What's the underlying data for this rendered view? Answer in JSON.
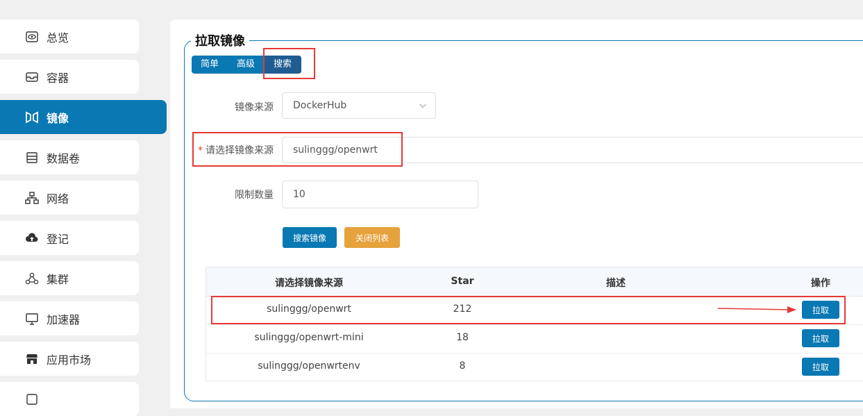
{
  "sidebar": {
    "items": [
      {
        "label": "总览",
        "icon": "eye-icon"
      },
      {
        "label": "容器",
        "icon": "inbox-icon"
      },
      {
        "label": "镜像",
        "icon": "image-icon",
        "active": true
      },
      {
        "label": "数据卷",
        "icon": "database-icon"
      },
      {
        "label": "网络",
        "icon": "network-icon"
      },
      {
        "label": "登记",
        "icon": "cloud-upload-icon"
      },
      {
        "label": "集群",
        "icon": "cluster-icon"
      },
      {
        "label": "加速器",
        "icon": "monitor-icon"
      },
      {
        "label": "应用市场",
        "icon": "store-icon"
      }
    ]
  },
  "panel": {
    "title": "拉取镜像",
    "tabs": [
      "简单",
      "高级",
      "搜索"
    ],
    "selected_tab": "搜索"
  },
  "form": {
    "source_label": "镜像来源",
    "source_value": "DockerHub",
    "required_mark": "*",
    "search_label": "请选择镜像来源",
    "search_value": "sulinggg/openwrt",
    "limit_label": "限制数量",
    "limit_value": "10",
    "search_button": "搜索镜像",
    "close_button": "关闭列表"
  },
  "table": {
    "headers": [
      "请选择镜像来源",
      "Star",
      "描述",
      "操作"
    ],
    "rows": [
      {
        "name": "sulinggg/openwrt",
        "star": "212",
        "desc": "",
        "action": "拉取"
      },
      {
        "name": "sulinggg/openwrt-mini",
        "star": "18",
        "desc": "",
        "action": "拉取"
      },
      {
        "name": "sulinggg/openwrtenv",
        "star": "8",
        "desc": "",
        "action": "拉取"
      }
    ]
  },
  "colors": {
    "primary": "#0a78b3",
    "warning": "#e6a23c",
    "annotation": "#e53935"
  }
}
